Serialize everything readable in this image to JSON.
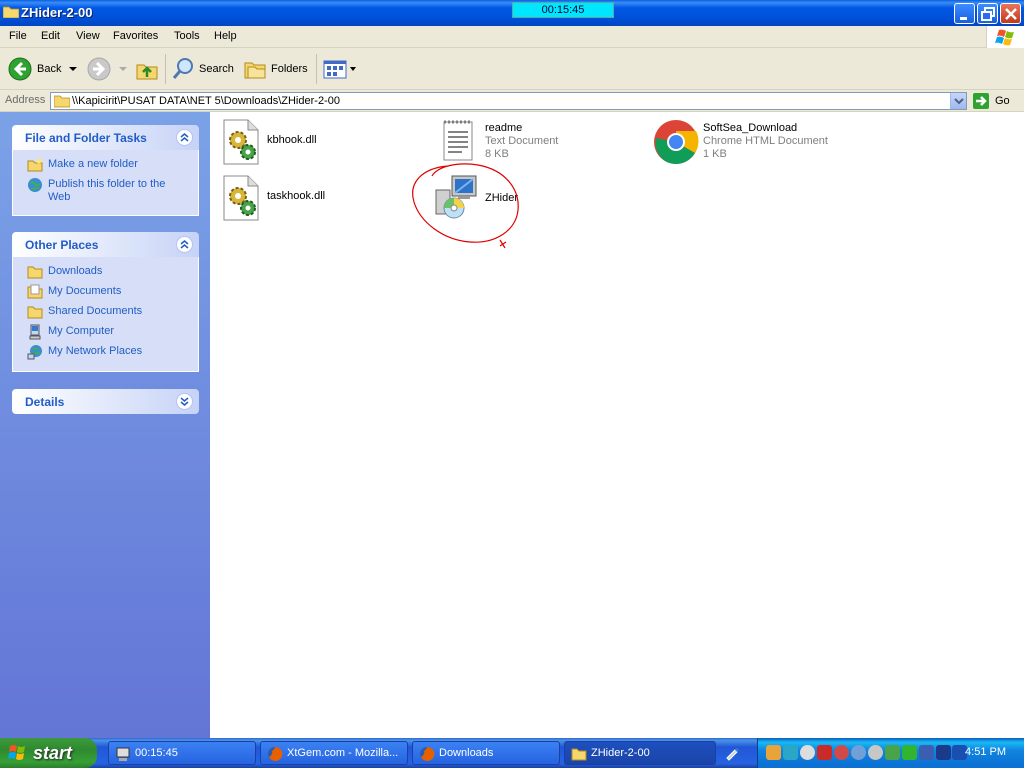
{
  "window": {
    "title": "ZHider-2-00",
    "timer_overlay": "00:15:45"
  },
  "menu": [
    "File",
    "Edit",
    "View",
    "Favorites",
    "Tools",
    "Help"
  ],
  "toolbar": {
    "back_label": "Back",
    "search_label": "Search",
    "folders_label": "Folders"
  },
  "address": {
    "label": "Address",
    "value": "\\\\Kapicirit\\PUSAT DATA\\NET 5\\Downloads\\ZHider-2-00",
    "go_label": "Go"
  },
  "taskpane": {
    "file_tasks": {
      "title": "File and Folder Tasks",
      "items": [
        "Make a new folder",
        "Publish this folder to the Web"
      ]
    },
    "other_places": {
      "title": "Other Places",
      "items": [
        "Downloads",
        "My Documents",
        "Shared Documents",
        "My Computer",
        "My Network Places"
      ]
    },
    "details": {
      "title": "Details"
    }
  },
  "files": [
    {
      "name": "kbhook.dll",
      "type": "",
      "size": "",
      "icon": "dll-icon"
    },
    {
      "name": "readme",
      "type": "Text Document",
      "size": "8 KB",
      "icon": "text-document-icon"
    },
    {
      "name": "SoftSea_Download",
      "type": "Chrome HTML Document",
      "size": "1 KB",
      "icon": "chrome-icon"
    },
    {
      "name": "taskhook.dll",
      "type": "",
      "size": "",
      "icon": "dll-icon"
    },
    {
      "name": "ZHider",
      "type": "",
      "size": "",
      "icon": "installer-icon"
    }
  ],
  "taskbar": {
    "start_label": "start",
    "buttons": [
      "00:15:45",
      "XtGem.com - Mozilla...",
      "Downloads",
      "ZHider-2-00"
    ],
    "clock": "4:51 PM"
  },
  "colors": {
    "title_bar": "#0054e3",
    "task_pane": "#6f8fe0",
    "link": "#215dc6",
    "annotation_circle": "#e00000"
  }
}
